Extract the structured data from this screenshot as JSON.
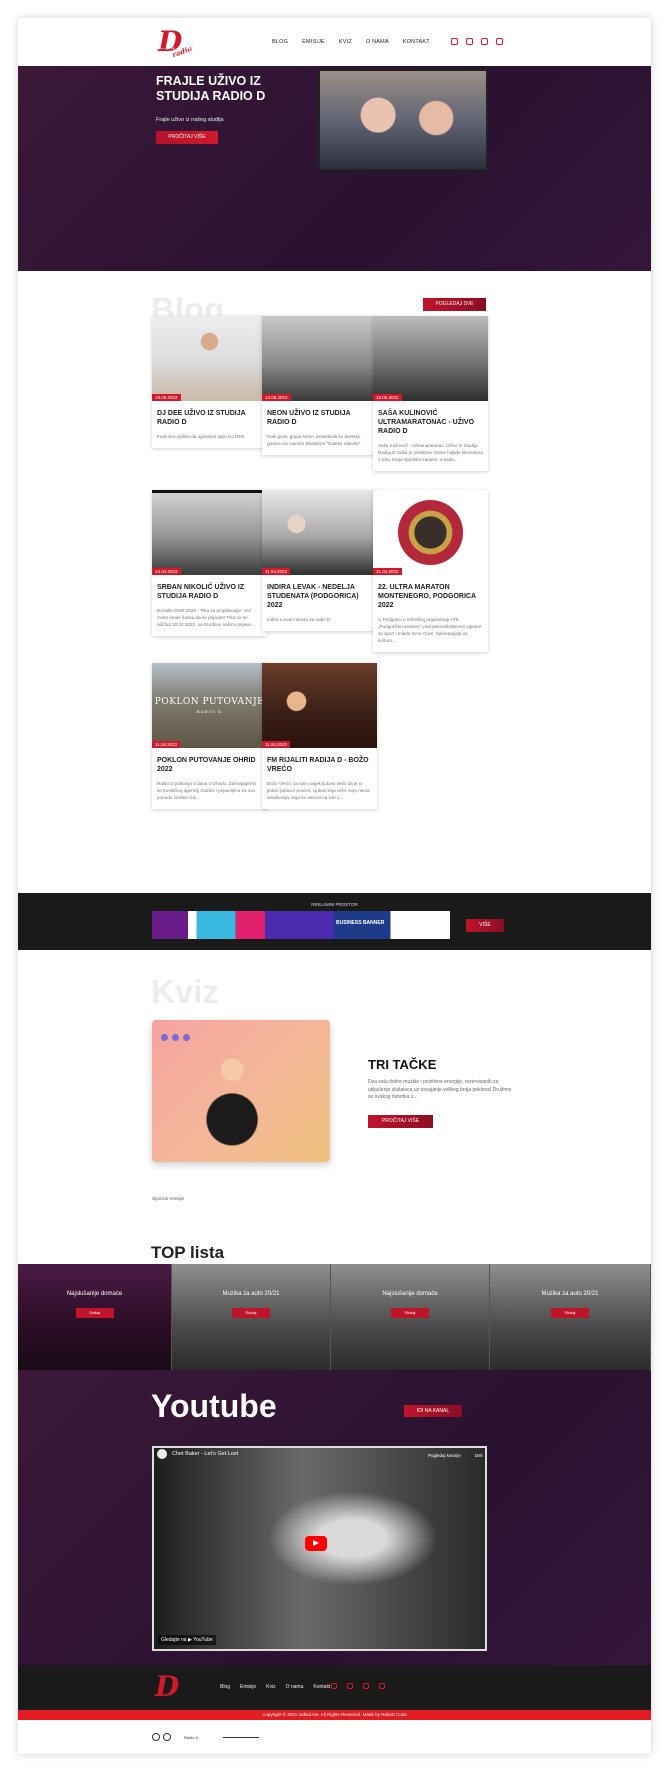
{
  "header": {
    "logo_text": "D",
    "logo_sub": "radio",
    "nav": [
      "BLOG",
      "EMISIJE",
      "KVIZ",
      "O NAMA",
      "KONTAKT"
    ],
    "social_icons": [
      "facebook-icon",
      "instagram-icon",
      "youtube-icon",
      "radio-icon"
    ]
  },
  "hero": {
    "arrows": "⟵ ⟶",
    "counter": "1/5",
    "title": "FRAJLE UŽIVO IZ STUDIJA RADIO D",
    "subtitle": "Frajle uživo iz našeg studija",
    "button": "PROČITAJ VIŠE"
  },
  "blog": {
    "heading": "Blog",
    "button": "POGLEDAJ SVE",
    "cards": [
      {
        "date": "19.08.2022",
        "title": "DJ DEE UŽIVO IZ STUDIJA RADIO D",
        "text": "Imali smo priliku da ugostimo spiju DJ DEE"
      },
      {
        "date": "13.06.2022",
        "title": "NEON UŽIVO IZ STUDIJA RADIO D",
        "text": "Naši gosti, grupa Neon, predstavili su duetsku pjesmu sa Ivanom Dedakom \"Daleko odavde\""
      },
      {
        "date": "18.05.2022",
        "title": "SAŠA KULINOVIĆ ULTRAMARATONAC - UŽIVO RADIO D",
        "text": "Saša Kulinović - Ultramaratonac. Uživo iz Studija Radija D Saša je predstavi stotne hiljada kilometara u toku svoje sportske karijere, a sada..."
      },
      {
        "date": "14.04.2022",
        "title": "SRĐAN NIKOLIĆ UŽIVO IZ STUDIJA RADIO D",
        "text": "Đurađin DOR 2022 - Trka za propisivanje. Već ovom imate šansu da se prijavite! Trka će se održati 30.04.2022. na Đurđevu načinu prijave..."
      },
      {
        "date": "11.04.2022",
        "title": "INDIRA LEVAK - NEDELJA STUDENATA (PODGORICA) 2022",
        "text": "Indira Levak intervju za radio D"
      },
      {
        "date": "31.04.2022",
        "title": "22. ULTRA MARATON MONTENEGRO, PODGORICA 2022",
        "text": "U Podgorici u tehničkoj organizaciji ATK „Podgorički maraton\", pod pokroviteljstvom Uprave za sport i mlade Crne Gore, Sekretarijata za kulturu..."
      },
      {
        "date": "11.04.2022",
        "title": "POKLON PUTOVANJE OHRID 2022",
        "text": "Radio D poklanja 5 dana u Ohridu. Zahvaljujemo se turističkoj agenciji Galileo i prijateljima za ovu ponudu Galileo CG."
      },
      {
        "date": "11.04.2022",
        "title": "FM RIJALITI RADIJA D - BOŽO VREĆO",
        "text": "Božo Vrećo: Ja sam uvijek ljubavi teklo da je to jedan ljubavni proces. Ljubav koja teče, koja nema osuđivanja, koja se odnosi na sve u..."
      }
    ],
    "card_image_text": "POKLON PUTOVANJE",
    "card_image_sub": "RADIO D"
  },
  "ads": {
    "label": "REKLAMNI PROSTOR",
    "banner_text": "BUSINESS BANNER",
    "button": "VIŠE"
  },
  "kviz": {
    "heading": "Kviz",
    "title": "TRI TAČKE",
    "text": "Dva sata dobre muzike i pozitivne energije, rezervisanih za uključenje slušalaca uz osvajanje velikog broja poklona! Družimo se svakog četvrtka u...",
    "button": "PROČITAJ VIŠE",
    "small": "Sponzor emisije"
  },
  "top": {
    "heading": "TOP lista",
    "items": [
      {
        "label": "Najslušanije domaće",
        "button": "Slušaj"
      },
      {
        "label": "Muzika za auto 20/21",
        "button": "Slušaj"
      },
      {
        "label": "Najslušanije domaće",
        "button": "Slušaj"
      },
      {
        "label": "Muzika za auto 20/21",
        "button": "Slušaj"
      }
    ]
  },
  "youtube": {
    "heading": "Youtube",
    "button": "IDI NA KANAL",
    "video_title": "Chet Baker - Let's Get Lost",
    "watch_later": "Pogledaj kasnije",
    "share": "Deli",
    "watch_on": "Gledajte na ▶ YouTube"
  },
  "footer": {
    "logo_text": "D",
    "nav": [
      "Blog",
      "Emisije",
      "Kviz",
      "O nama",
      "Kontakt"
    ],
    "copyright": "Copyright © 2021 radiod.me. All Rights Reserved. Made by Robert Coda",
    "player_name": "Radio D"
  }
}
